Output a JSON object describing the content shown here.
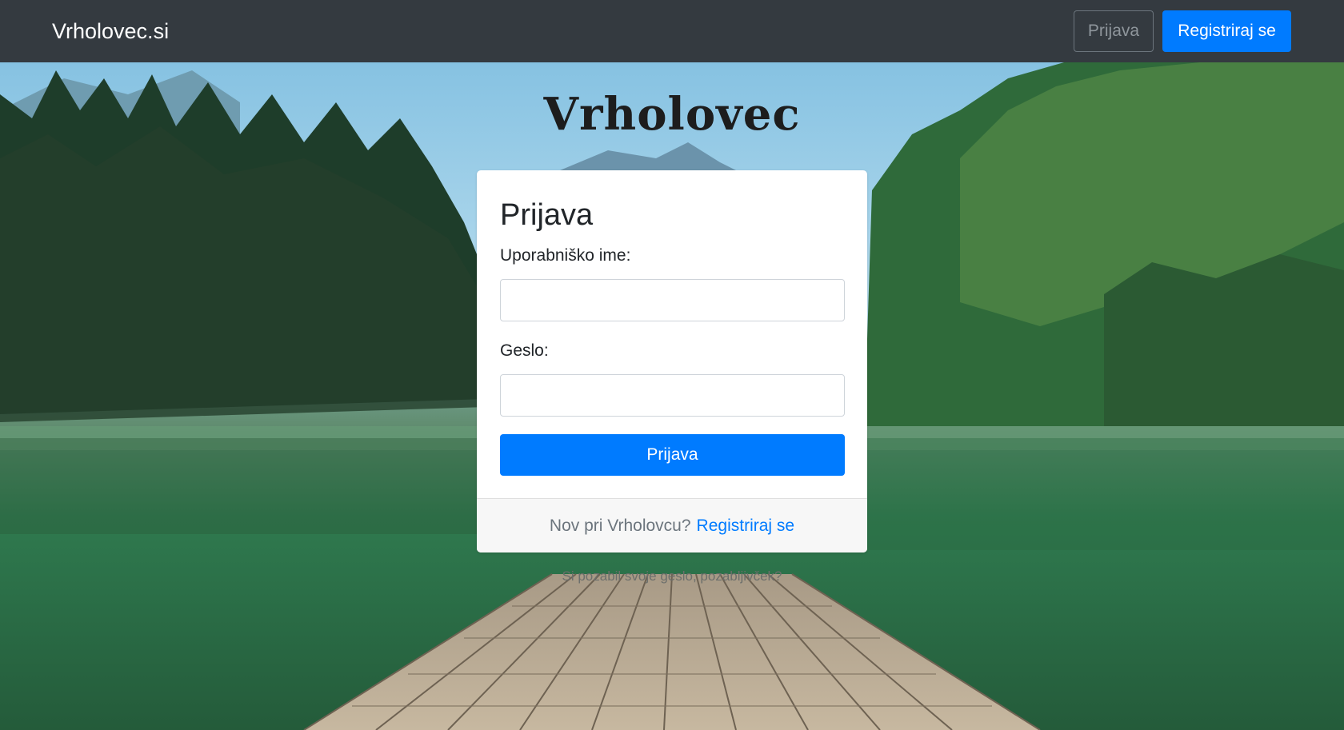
{
  "navbar": {
    "brand": "Vrholovec.si",
    "login_label": "Prijava",
    "register_label": "Registriraj se"
  },
  "hero": {
    "logo_text": "Vrholovec"
  },
  "login_card": {
    "title": "Prijava",
    "username_label": "Uporabniško ime:",
    "username_value": "",
    "password_label": "Geslo:",
    "password_value": "",
    "submit_label": "Prijava",
    "footer_text": "Nov pri Vrholovcu?",
    "footer_link": "Registriraj se"
  },
  "forgot_text": "Si pozabil svoje geslo, pozabljivček?",
  "colors": {
    "navbar_bg": "#343a40",
    "primary": "#007bff",
    "card_bg": "#ffffff",
    "footer_bg": "#f7f7f7"
  }
}
